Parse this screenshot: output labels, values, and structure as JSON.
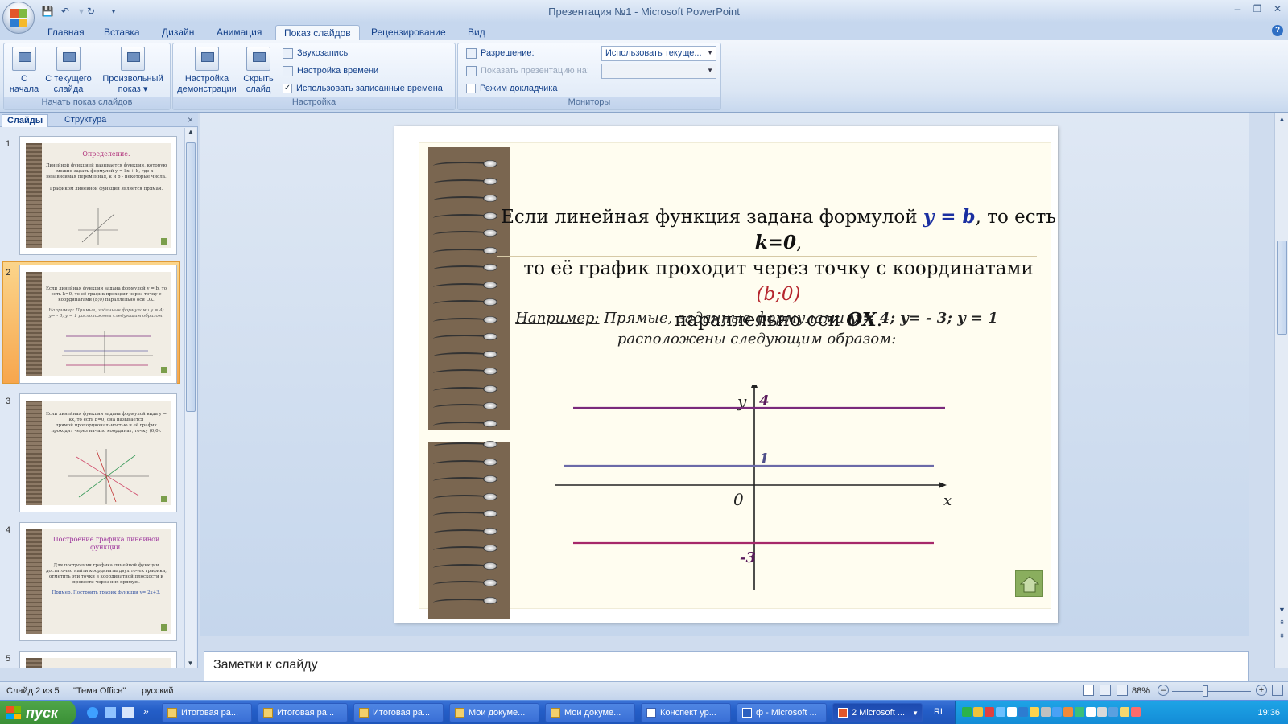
{
  "window": {
    "title": "Презентация №1 - Microsoft PowerPoint"
  },
  "qat": {
    "icons": [
      "save-icon",
      "undo-icon",
      "redo-icon",
      "customize-icon"
    ]
  },
  "ribbon_tabs": [
    "Главная",
    "Вставка",
    "Дизайн",
    "Анимация",
    "Показ слайдов",
    "Рецензирование",
    "Вид"
  ],
  "active_tab": "Показ слайдов",
  "groups": {
    "start_show": {
      "label": "Начать показ слайдов",
      "buttons": [
        {
          "line1": "С",
          "line2": "начала"
        },
        {
          "line1": "С текущего",
          "line2": "слайда"
        },
        {
          "line1": "Произвольный",
          "line2": "показ ▾"
        }
      ]
    },
    "setup": {
      "label": "Настройка",
      "buttons": [
        {
          "line1": "Настройка",
          "line2": "демонстрации"
        },
        {
          "line1": "Скрыть",
          "line2": "слайд"
        }
      ],
      "small": [
        "Звукозапись",
        "Настройка времени",
        "Использовать записанные времена"
      ],
      "use_timings_checked": true
    },
    "monitors": {
      "label": "Мониторы",
      "resolution_label": "Разрешение:",
      "resolution_value": "Использовать текуще...",
      "show_on_label": "Показать презентацию на:",
      "show_on_value": "",
      "presenter_view_label": "Режим докладчика",
      "presenter_view_checked": false
    }
  },
  "slides_pane": {
    "tabs": [
      "Слайды",
      "Структура"
    ],
    "close": "×",
    "thumbnails": [
      {
        "num": "1",
        "title": "Определение.",
        "text": "Линейной функцией называется функция, которую можно задать формулой y = kx + b, где x - независимая переменная, k и b - некоторые числа.",
        "text2": "Графиком линейной функции является прямая."
      },
      {
        "num": "2",
        "title": "",
        "text": "Если линейная функция задана формулой y = b, то есть k=0, то её график проходит через точку с координатами (b;0) параллельно оси OX.",
        "text2": "Например: Прямые, заданные формулами y = 4; y= - 3; y = 1 расположены следующим образом:"
      },
      {
        "num": "3",
        "title": "",
        "text": "Если линейная функция задана формулой вида y = kx, то есть b=0, она называется",
        "text2": "прямой пропорциональностью и её график проходит через начало координат, точку (0;0)."
      },
      {
        "num": "4",
        "title": "Построение графика линейной функции.",
        "text": "Для построения графика линейной функции достаточно найти координаты двух точек графика, отметить эти точки в координатной плоскости и провести через них прямую.",
        "text2": "Пример. Построить график функции y= 2x+3."
      },
      {
        "num": "5",
        "title": "",
        "text": "",
        "text2": ""
      }
    ]
  },
  "slide": {
    "line1_pre": "Если линейная функция задана формулой ",
    "line1_math": "y = b",
    "line1_mid": ", то есть ",
    "line1_math2": "k=0",
    "line1_end": ",",
    "line2_pre": "то её график проходит через точку с координатами ",
    "line2_math": "(b;0)",
    "line3_pre": "параллельно оси ",
    "line3_math": "OX",
    "line3_end": ".",
    "example_label": "Например:",
    "example_text": " Прямые, заданные формулами ",
    "example_formulas": "y = 4; y= - 3; y = 1",
    "example_text2": "расположены следующим образом:",
    "graph": {
      "y_axis_label": "y",
      "x_axis_label": "x",
      "origin_label": "0",
      "lines": [
        {
          "label": "4",
          "value": 4,
          "color": "#7a2a7c"
        },
        {
          "label": "1",
          "value": 1,
          "color": "#6b6aa8"
        },
        {
          "label": "-3",
          "value": -3,
          "color": "#a6286a"
        }
      ]
    }
  },
  "notes": {
    "placeholder": "Заметки к слайду"
  },
  "status": {
    "slide": "Слайд 2 из 5",
    "theme": "\"Тема Office\"",
    "language": "русский",
    "zoom": "88%"
  },
  "taskbar": {
    "start": "пуск",
    "items": [
      "Итоговая ра...",
      "Итоговая ра...",
      "Итоговая ра...",
      "Мои докуме...",
      "Мои докуме...",
      "Конспект ур...",
      "ф - Microsoft ...",
      "2 Microsoft ..."
    ],
    "lang": "RL",
    "clock": "19:36"
  },
  "colors": {
    "ribbon_blue": "#15428b",
    "math_blue": "#1a2fa0",
    "math_red": "#b5252d",
    "accent": "#f7a64d"
  }
}
